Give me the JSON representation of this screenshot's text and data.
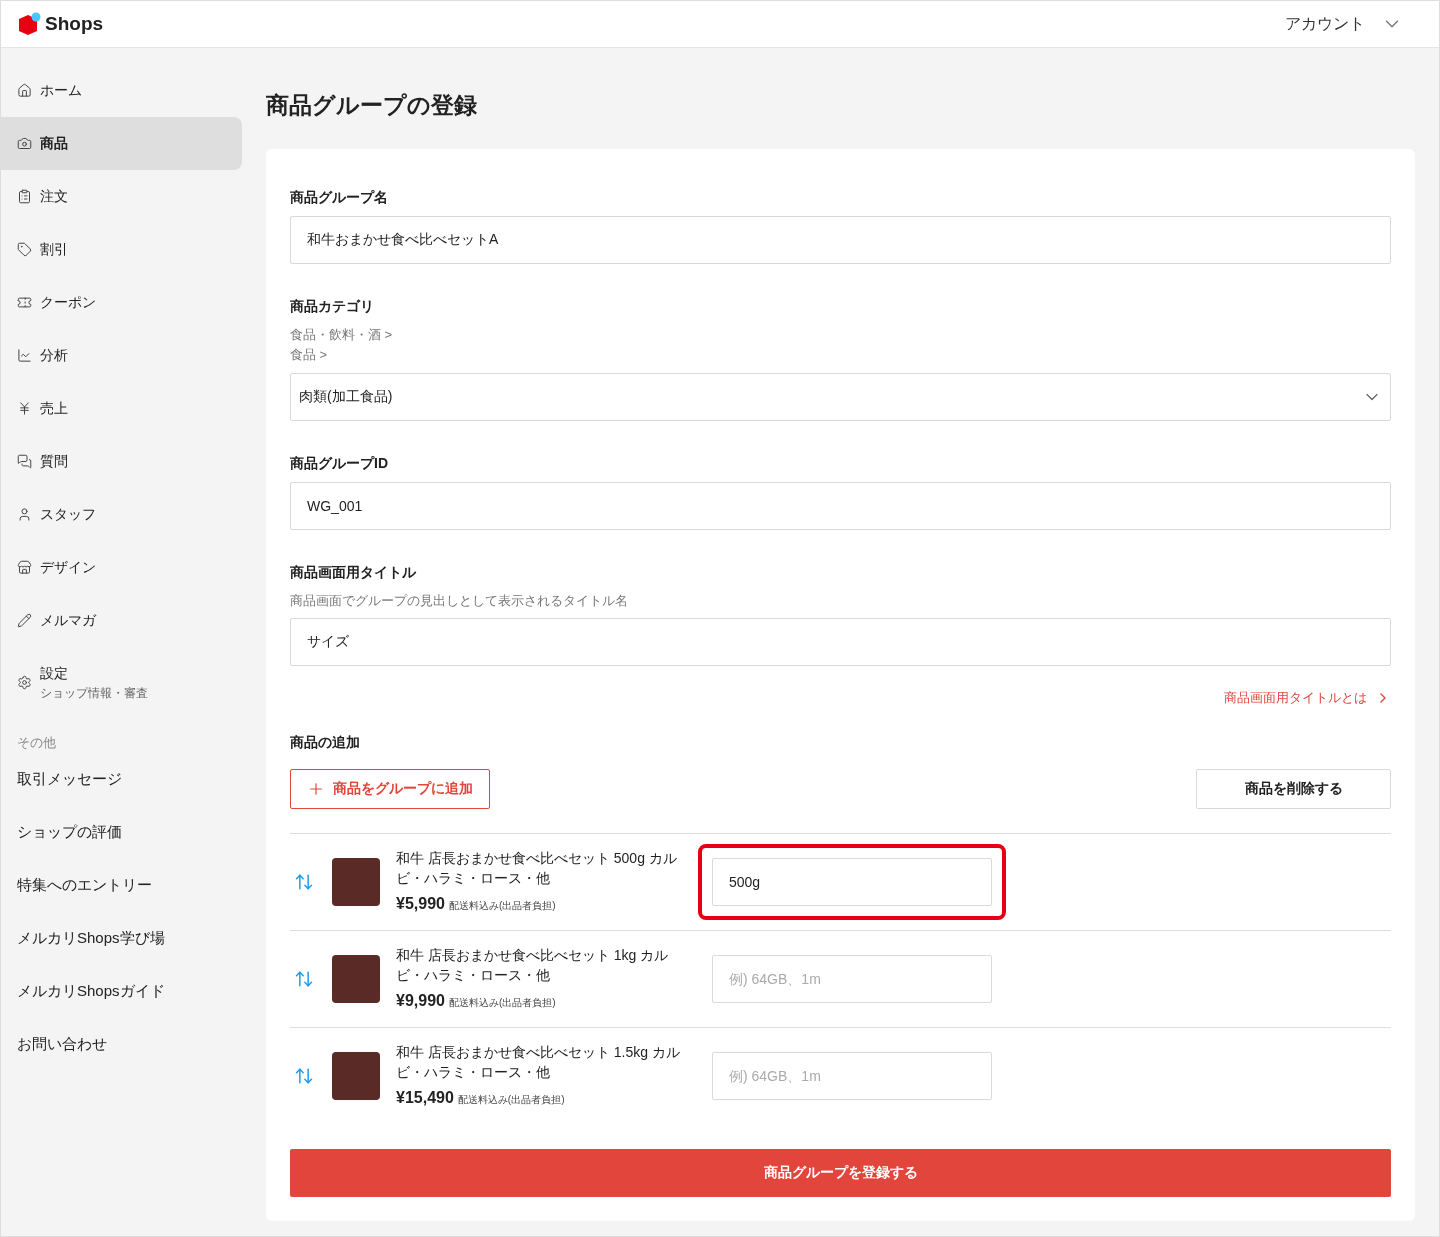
{
  "header": {
    "logo": "Shops",
    "account": "アカウント"
  },
  "sidebar": {
    "items": [
      {
        "label": "ホーム",
        "selected": false
      },
      {
        "label": "商品",
        "selected": true
      },
      {
        "label": "注文",
        "selected": false
      },
      {
        "label": "割引",
        "selected": false
      },
      {
        "label": "クーポン",
        "selected": false
      },
      {
        "label": "分析",
        "selected": false
      },
      {
        "label": "売上",
        "selected": false
      },
      {
        "label": "質問",
        "selected": false
      },
      {
        "label": "スタッフ",
        "selected": false
      },
      {
        "label": "デザイン",
        "selected": false
      },
      {
        "label": "メルマガ",
        "selected": false
      },
      {
        "label": "設定",
        "sublabel": "ショップ情報・審査",
        "selected": false
      }
    ],
    "other_heading": "その他",
    "other_items": [
      "取引メッセージ",
      "ショップの評価",
      "特集へのエントリー",
      "メルカリShops学び場",
      "メルカリShopsガイド",
      "お問い合わせ"
    ]
  },
  "page_title": "商品グループの登録",
  "form": {
    "group_name": {
      "label": "商品グループ名",
      "value": "和牛おまかせ食べ比べセットA"
    },
    "category": {
      "label": "商品カテゴリ",
      "path": [
        "食品・飲料・酒 >",
        "食品 >"
      ],
      "value": "肉類(加工食品)"
    },
    "group_id": {
      "label": "商品グループID",
      "value": "WG_001"
    },
    "screen_title": {
      "label": "商品画面用タイトル",
      "help": "商品画面でグループの見出しとして表示されるタイトル名",
      "value": "サイズ",
      "link": "商品画面用タイトルとは"
    },
    "add_section": {
      "label": "商品の追加",
      "add_button": "商品をグループに追加",
      "delete_button": "商品を削除する"
    },
    "products": [
      {
        "title": "和牛 店長おまかせ食べ比べセット 500g カルビ・ハラミ・ロース・他",
        "price": "¥5,990",
        "shipping": "配送料込み(出品者負担)",
        "value": "500g",
        "highlighted": true
      },
      {
        "title": "和牛 店長おまかせ食べ比べセット 1kg カルビ・ハラミ・ロース・他",
        "price": "¥9,990",
        "shipping": "配送料込み(出品者負担)",
        "placeholder": "例) 64GB、1m",
        "highlighted": false
      },
      {
        "title": "和牛 店長おまかせ食べ比べセット 1.5kg カルビ・ハラミ・ロース・他",
        "price": "¥15,490",
        "shipping": "配送料込み(出品者負担)",
        "placeholder": "例) 64GB、1m",
        "highlighted": false
      }
    ],
    "submit": "商品グループを登録する"
  }
}
